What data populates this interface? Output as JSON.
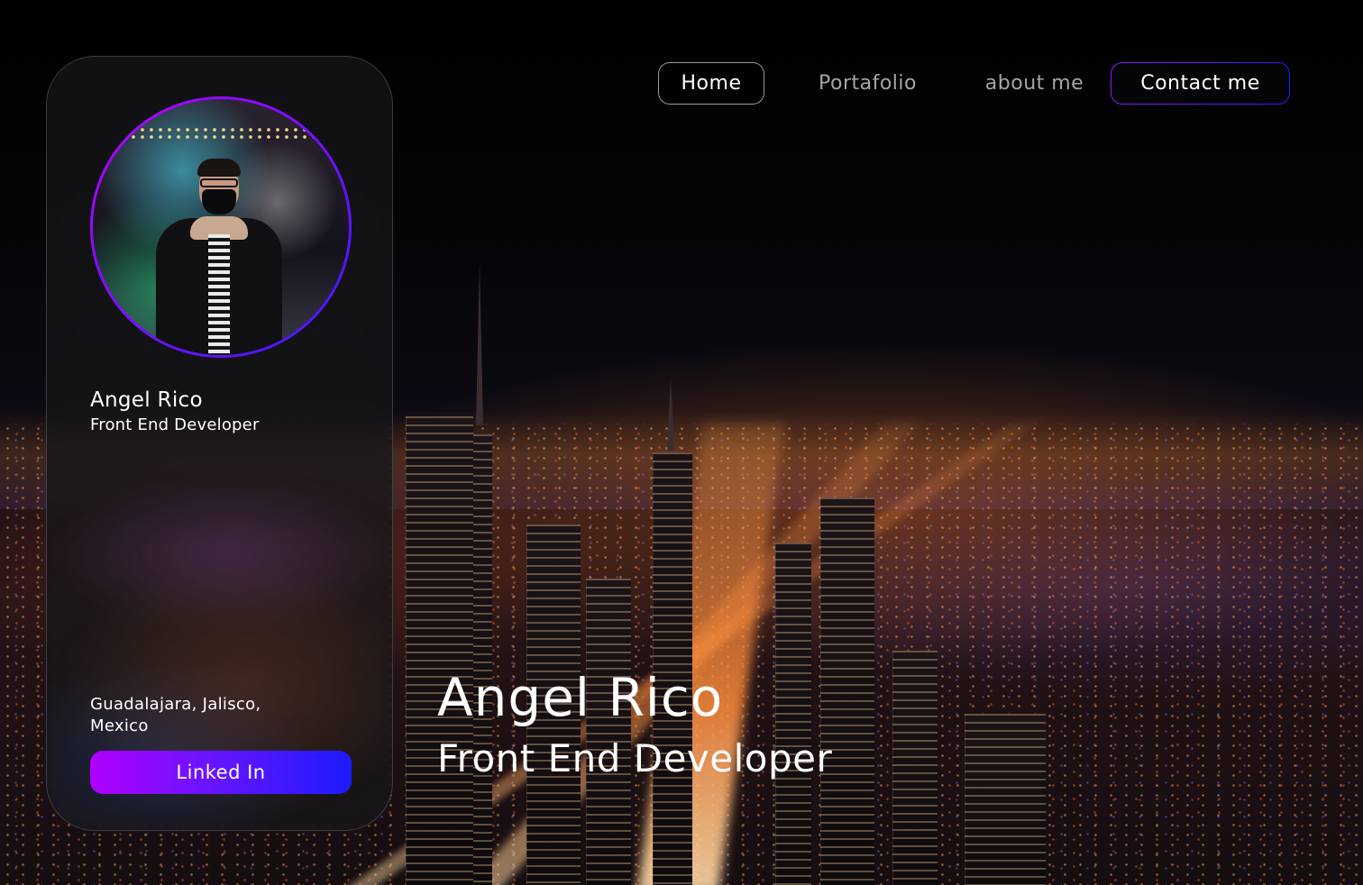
{
  "nav": {
    "items": [
      {
        "label": "Home"
      },
      {
        "label": "Portafolio"
      },
      {
        "label": "about me"
      },
      {
        "label": "Contact me"
      }
    ]
  },
  "card": {
    "name": "Angel Rico",
    "role": "Front End Developer",
    "location": "Guadalajara, Jalisco, Mexico",
    "linkedin_label": "Linked In"
  },
  "hero": {
    "name": "Angel Rico",
    "role": "Front End Developer"
  },
  "colors": {
    "accent_purple": "#b000ff",
    "accent_blue": "#1d1bff",
    "nav_inactive": "#a5a5a5"
  }
}
